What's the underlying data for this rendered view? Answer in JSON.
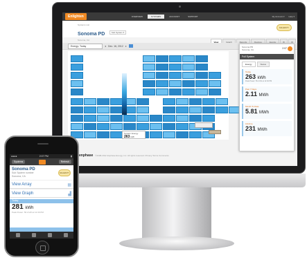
{
  "desktop": {
    "topnav": {
      "logo": "Enlighten",
      "items": [
        "OVERVIEW",
        "SYSTEMS",
        "ACCOUNT",
        "SUPPORT"
      ],
      "active_index": 1,
      "right": [
        "My Account ▾",
        "Help ▾"
      ]
    },
    "header": {
      "breadcrumb": "Systems List",
      "system_name": "Sonoma PD",
      "selector": "Sub System ▾",
      "sub": "Sonoma, CA",
      "corner_logo": "SOLARCITY"
    },
    "tabs": [
      "View",
      "Graph",
      "Reports",
      "Devices",
      "Events"
    ],
    "toolbar": {
      "period": "Energy: Today",
      "date": "Dec. 16, 2012"
    },
    "legend": {
      "label": "System Energy",
      "value": "263",
      "unit": "kWh"
    },
    "panel_label": "261",
    "panel": {
      "location": "Sonoma PD",
      "location_sub": "Sonoma, CA",
      "time": "2:07",
      "title": "Full System",
      "tabs": [
        "Energy",
        "Status"
      ],
      "metrics": [
        {
          "label": "Today",
          "value": "263",
          "unit": "kWh",
          "note": "Peak Power: 56.2 kW at 12:30 PM"
        },
        {
          "label": "Past 7 Days",
          "value": "2.11",
          "unit": "MWh",
          "note": ""
        },
        {
          "label": "Month To Date",
          "value": "5.81",
          "unit": "MWh",
          "note": ""
        },
        {
          "label": "Lifetime",
          "value": "231",
          "unit": "MWh",
          "note": ""
        }
      ]
    },
    "footer": {
      "brand": "enphase",
      "text": "©2008-2012 Enphase Energy, Inc. All rights reserved. Privacy  Terms  Comments"
    }
  },
  "mobile": {
    "status_left": "●●●●",
    "status_time": "2:07 PM",
    "nav_left": "Systems",
    "nav_right": "Refresh",
    "system_name": "Sonoma PD",
    "sub1": "Sub System number",
    "sub2": "Sonoma, CA",
    "logo": "SOLARCITY",
    "links": [
      "View Array",
      "View Graph"
    ],
    "energy_label": "Today",
    "energy_value": "281",
    "energy_unit": "kWh",
    "peak": "Peak Power: 56.2 kW at 12:30 PM"
  }
}
